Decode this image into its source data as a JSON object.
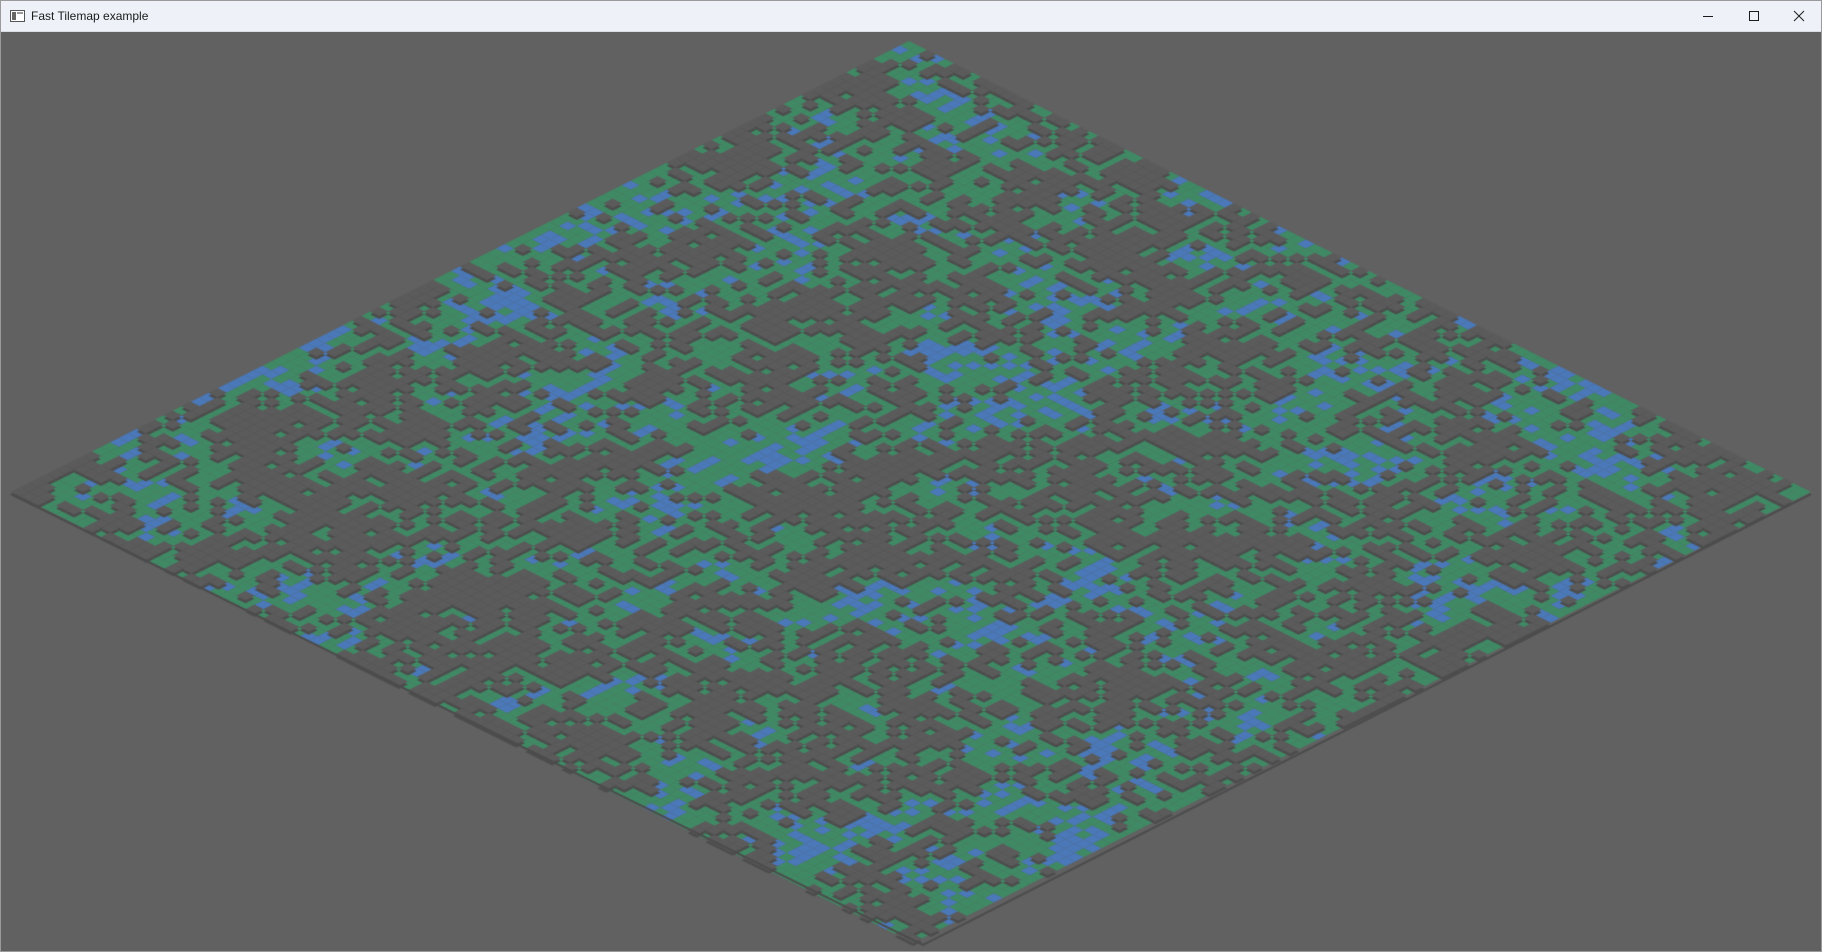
{
  "window": {
    "title": "Fast Tilemap example",
    "controls": {
      "minimize_icon": "minimize-icon",
      "maximize_icon": "maximize-icon",
      "close_icon": "close-icon"
    }
  },
  "tilemap": {
    "projection": "isometric",
    "background_color": "#616161",
    "tile_colors": {
      "ground": "#5b5b5b",
      "grass": "#3f8a65",
      "water": "#4a78b8"
    }
  }
}
